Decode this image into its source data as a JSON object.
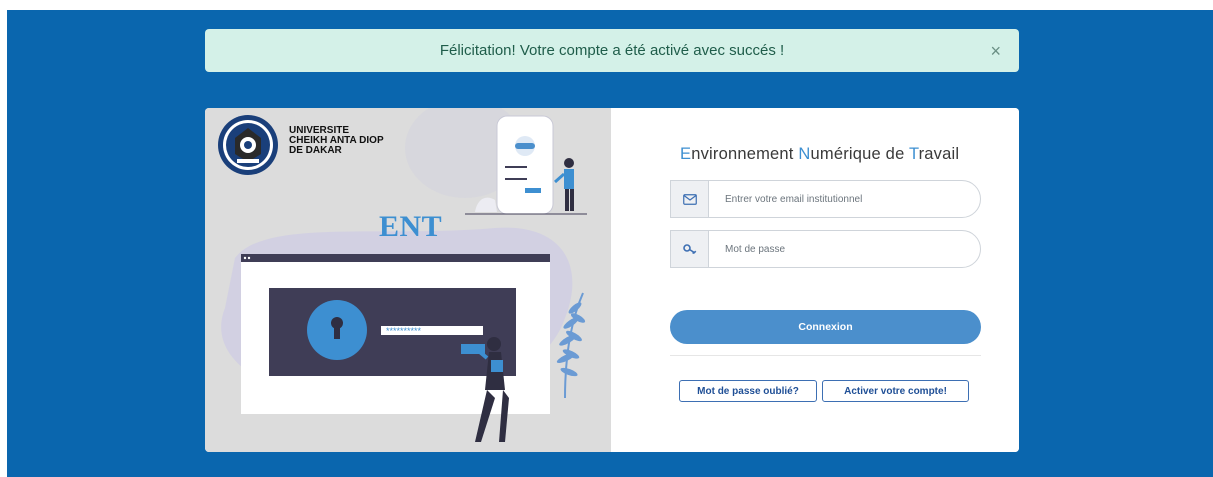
{
  "alert": {
    "message": "Félicitation! Votre compte a été activé avec succés !",
    "close_label": "×"
  },
  "university": {
    "line1": "UNIVERSITE",
    "line2": "CHEIKH ANTA DIOP",
    "line3": "DE DAKAR"
  },
  "illustration": {
    "title": "ENT",
    "password_mask": "**********"
  },
  "login": {
    "title_parts": [
      "E",
      "nvironnement ",
      "N",
      "umérique de ",
      "T",
      "ravail"
    ],
    "email_placeholder": "Entrer votre email institutionnel",
    "password_placeholder": "Mot de passe",
    "submit_label": "Connexion",
    "forgot_label": "Mot de passe oublié?",
    "activate_label": "Activer votre compte!"
  },
  "colors": {
    "page_background": "#0a66ae",
    "alert_background": "#d4f1e8",
    "accent": "#3d8fd1",
    "button": "#4b8fcc"
  },
  "icons": {
    "email": "envelope-icon",
    "password": "key-icon",
    "close": "close-icon"
  }
}
